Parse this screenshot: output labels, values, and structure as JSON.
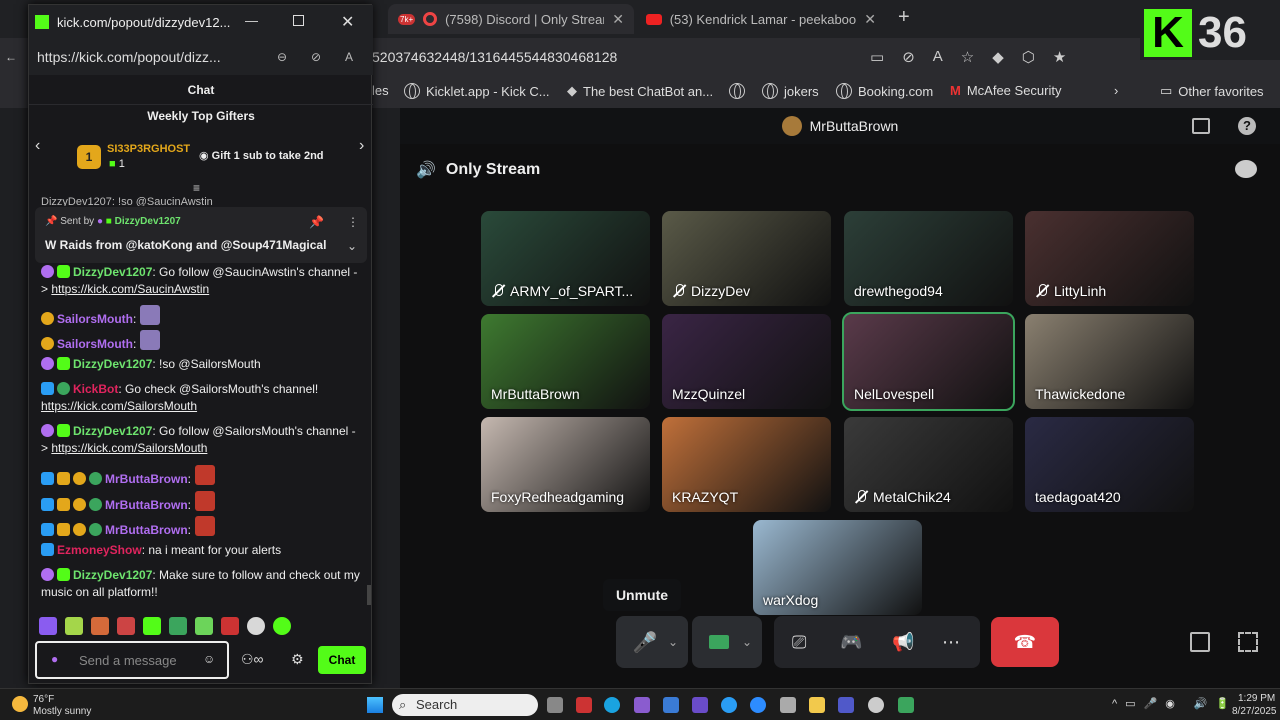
{
  "browser": {
    "tabs": [
      {
        "label": "(7598) Discord | Only Stream",
        "badge": "7k+"
      },
      {
        "label": "(53) Kendrick Lamar - peekaboo ("
      }
    ],
    "url": "520374632448/1316445544830468128",
    "bookmarks": [
      "les",
      "Kicklet.app - Kick C...",
      "The best ChatBot an...",
      "jokers",
      "Booking.com",
      "McAfee Security"
    ],
    "other_favorites": "Other favorites"
  },
  "overlay": {
    "logo": "K",
    "number": "36"
  },
  "popup": {
    "title": "kick.com/popout/dizzydev12...",
    "url": "https://kick.com/popout/dizz...",
    "chat_header": "Chat",
    "gifters_title": "Weekly Top Gifters",
    "gifter_name": "SI33P3RGHOST",
    "gifter_count": "1",
    "gifter_rank": "1",
    "gift_hint": "Gift 1 sub to take 2nd",
    "cut_text": "DizzyDev1207: !so @SaucinAwstin",
    "pinned_by_label": "Sent by",
    "pinned_by_name": "DizzyDev1207",
    "pinned_text": "W Raids from @katoKong and @Soup471Magical",
    "messages": [
      {
        "name": "DizzyDev1207",
        "color": "#6ee36e",
        "text": ": Go follow @SaucinAwstin's channel - > ",
        "link": "https://kick.com/SaucinAwstin"
      },
      {
        "name": "SailorsMouth",
        "color": "#b06ef0",
        "text": ":"
      },
      {
        "name": "SailorsMouth",
        "color": "#b06ef0",
        "text": ":"
      },
      {
        "name": "DizzyDev1207",
        "color": "#6ee36e",
        "text": ": !so @SailorsMouth"
      },
      {
        "name": "KickBot",
        "color": "#e0245e",
        "text": ": Go check @SailorsMouth's channel! ",
        "link": "https://kick.com/SailorsMouth"
      },
      {
        "name": "DizzyDev1207",
        "color": "#6ee36e",
        "text": ": Go follow @SailorsMouth's channel - > ",
        "link": "https://kick.com/SailorsMouth"
      },
      {
        "name": "MrButtaBrown",
        "color": "#b06ef0",
        "text": ":"
      },
      {
        "name": "MrButtaBrown",
        "color": "#b06ef0",
        "text": ":"
      },
      {
        "name": "MrButtaBrown",
        "color": "#b06ef0",
        "text": ":"
      },
      {
        "name": "EzmoneyShow",
        "color": "#e0245e",
        "text": ": na i meant for your alerts"
      },
      {
        "name": "DizzyDev1207",
        "color": "#6ee36e",
        "text": ": Make sure to follow and check out my music on all platform!!"
      }
    ],
    "input_placeholder": "Send a message",
    "chat_button": "Chat"
  },
  "discord": {
    "server": "MrButtaBrown",
    "channel": "Only Stream",
    "tiles": [
      {
        "name": "ARMY_of_SPART...",
        "muted": true,
        "bg": "#2a4a3a"
      },
      {
        "name": "DizzyDev",
        "muted": true,
        "bg": "#5a5a48"
      },
      {
        "name": "drewthegod94",
        "muted": false,
        "bg": "#2c3f38"
      },
      {
        "name": "LittyLinh",
        "muted": true,
        "bg": "#4a3030"
      },
      {
        "name": "MrButtaBrown",
        "muted": false,
        "bg": "#3e7a30"
      },
      {
        "name": "MzzQuinzel",
        "muted": false,
        "bg": "#3a2545"
      },
      {
        "name": "NelLovespell",
        "muted": false,
        "bg": "#5a3a4a"
      },
      {
        "name": "Thawickedone",
        "muted": false,
        "bg": "#8a8070"
      },
      {
        "name": "FoxyRedheadgaming",
        "muted": false,
        "bg": "#c5b8b0"
      },
      {
        "name": "KRAZYQT",
        "muted": false,
        "bg": "#c0703a"
      },
      {
        "name": "MetalChik24",
        "muted": true,
        "bg": "#3a3a3a"
      },
      {
        "name": "taedagoat420",
        "muted": false,
        "bg": "#2a2a44"
      },
      {
        "name": "warXdog",
        "muted": false,
        "bg": "#9ab8d0"
      }
    ],
    "tooltip": "Unmute"
  },
  "taskbar": {
    "weather_temp": "76°F",
    "weather_desc": "Mostly sunny",
    "search": "Search",
    "time": "1:29 PM",
    "date": "8/27/2025"
  }
}
